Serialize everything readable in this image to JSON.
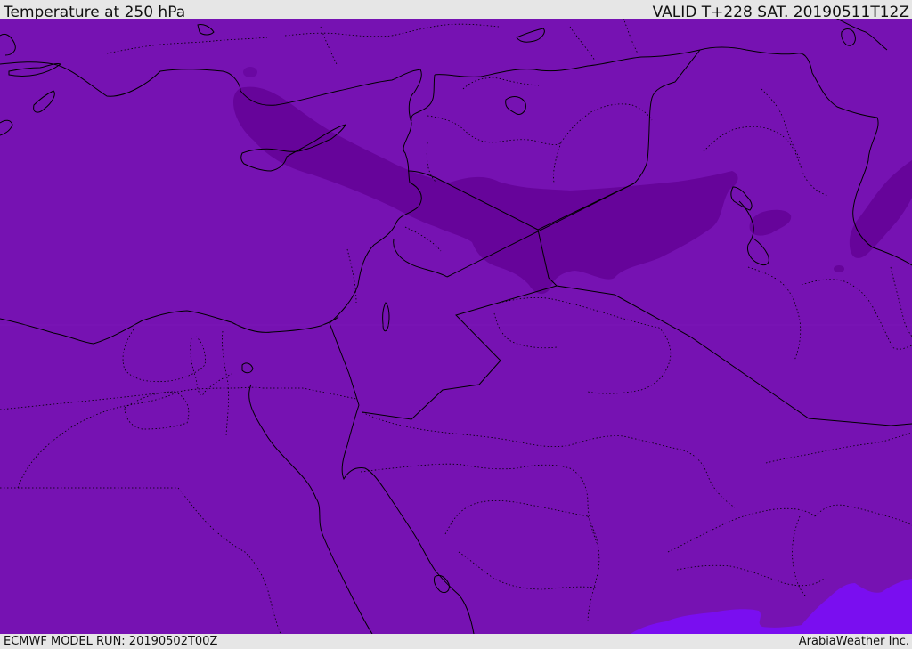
{
  "header": {
    "title": "Temperature at 250 hPa",
    "valid_time": "VALID T+228 SAT. 20190511T12Z"
  },
  "footer": {
    "model_run": "ECMWF MODEL RUN: 20190502T00Z",
    "credit": "ArabiaWeather Inc."
  },
  "colors": {
    "base_fill": "#7612b2",
    "cold_band": "#66049a",
    "warm_patch": "#7a0ef0",
    "coastline": "#000000",
    "frame": "#e6e6e6"
  }
}
